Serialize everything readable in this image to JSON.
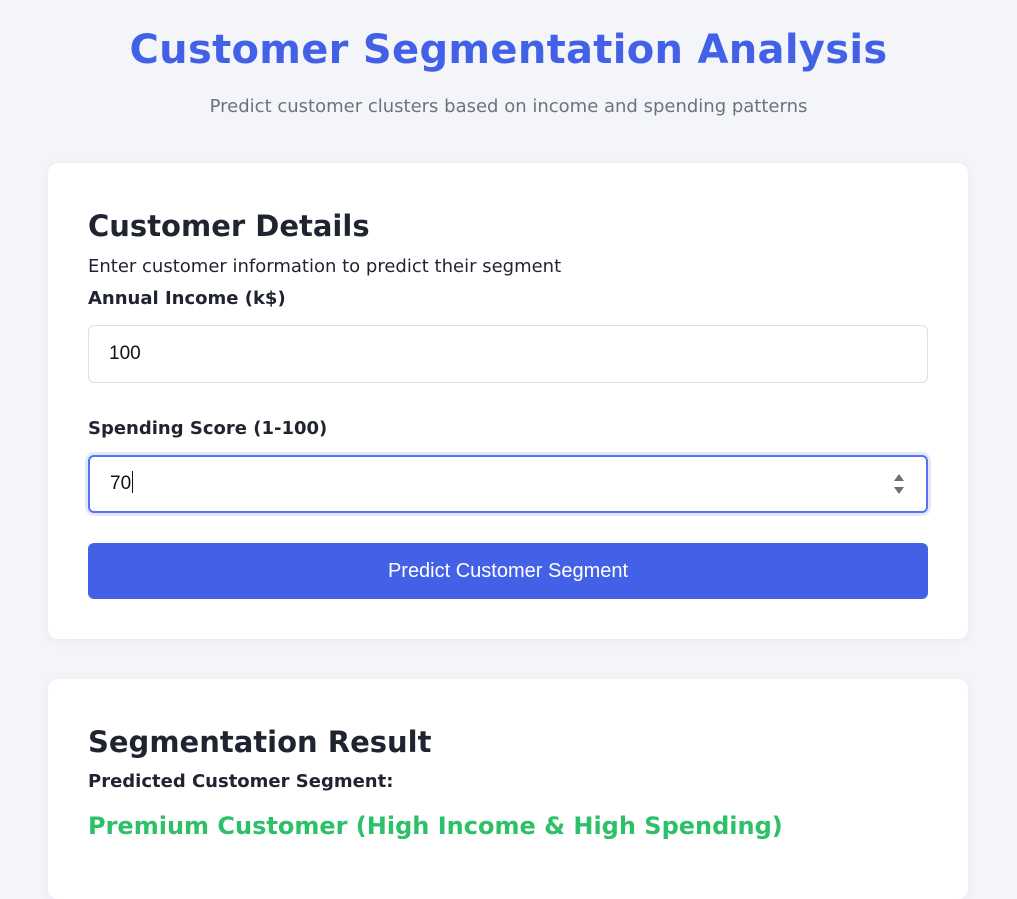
{
  "header": {
    "title": "Customer Segmentation Analysis",
    "subtitle": "Predict customer clusters based on income and spending patterns"
  },
  "details_card": {
    "title": "Customer Details",
    "description": "Enter customer information to predict their segment",
    "income": {
      "label": "Annual Income (k$)",
      "value": "100"
    },
    "spending": {
      "label": "Spending Score (1-100)",
      "value": "70"
    },
    "predict_button_label": "Predict Customer Segment"
  },
  "result_card": {
    "title": "Segmentation Result",
    "label": "Predicted Customer Segment:",
    "value": "Premium Customer (High Income & High Spending)"
  },
  "colors": {
    "accent": "#4361e6",
    "success": "#2cc068",
    "background": "#f4f5f9"
  },
  "icons": {
    "stepper": "number-stepper-icon"
  }
}
